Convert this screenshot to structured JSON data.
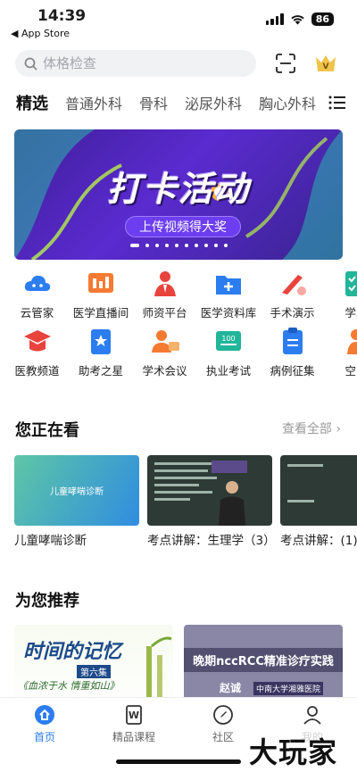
{
  "status": {
    "time": "14:39",
    "back_app": "◀ App Store",
    "battery": "86"
  },
  "search": {
    "placeholder": "体格检查"
  },
  "tabs": [
    "精选",
    "普通外科",
    "骨科",
    "泌尿外科",
    "胸心外科"
  ],
  "banner": {
    "title": "打卡活动",
    "subtitle": "上传视频得大奖",
    "dot_count": 10,
    "active_dot": 0
  },
  "grid": [
    [
      {
        "label": "云管家",
        "icon": "cloud-icon",
        "color": "#2b7df0"
      },
      {
        "label": "医学直播间",
        "icon": "live-icon",
        "color": "#f57a32"
      },
      {
        "label": "师资平台",
        "icon": "teacher-icon",
        "color": "#e8433c"
      },
      {
        "label": "医学资料库",
        "icon": "folder-icon",
        "color": "#2b7df0"
      },
      {
        "label": "手术演示",
        "icon": "scalpel-icon",
        "color": "#e8433c"
      },
      {
        "label": "学术",
        "icon": "checklist-icon",
        "color": "#21b59a"
      }
    ],
    [
      {
        "label": "医教频道",
        "icon": "graduation-icon",
        "color": "#e8433c"
      },
      {
        "label": "助考之星",
        "icon": "star-book-icon",
        "color": "#2b7df0"
      },
      {
        "label": "学术会议",
        "icon": "meeting-icon",
        "color": "#f57a32"
      },
      {
        "label": "执业考试",
        "icon": "exam-icon",
        "color": "#21b59a"
      },
      {
        "label": "病例征集",
        "icon": "clipboard-icon",
        "color": "#2b7df0"
      },
      {
        "label": "空中",
        "icon": "person-icon",
        "color": "#f57a32"
      }
    ]
  ],
  "watching": {
    "title": "您正在看",
    "see_all": "查看全部",
    "items": [
      {
        "title": "儿童哮喘诊断",
        "thumb_text": "儿童哮喘诊断"
      },
      {
        "title": "考点讲解：生理学（3）",
        "thumb_text": ""
      },
      {
        "title": "考点讲解：(1)",
        "thumb_text": ""
      }
    ]
  },
  "recommend": {
    "title": "为您推荐",
    "items": [
      {
        "title": "时间的记忆",
        "tag": "第六集",
        "caption": "《血浓于水 情重如山》"
      },
      {
        "title": "晚期nccRCC精准诊疗实践",
        "speaker": "赵诚",
        "hospital": "中南大学湘雅医院"
      }
    ]
  },
  "nav": [
    {
      "label": "首页",
      "icon": "home-icon",
      "active": true
    },
    {
      "label": "精品课程",
      "icon": "course-icon",
      "active": false
    },
    {
      "label": "社区",
      "icon": "community-icon",
      "active": false
    },
    {
      "label": "我的",
      "icon": "profile-icon",
      "active": false
    }
  ],
  "watermark": "大玩家",
  "colors": {
    "accent": "#2b7df0",
    "banner": "#4a27b8"
  }
}
